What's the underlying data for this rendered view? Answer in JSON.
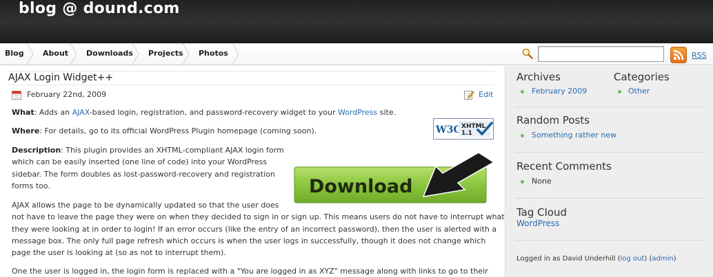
{
  "header": {
    "site_title": "blog @ dound.com"
  },
  "nav": {
    "items": [
      "Blog",
      "About",
      "Downloads",
      "Projects",
      "Photos"
    ],
    "search_placeholder": "",
    "rss_label": "RSS"
  },
  "post": {
    "title": "AJAX Login Widget++",
    "date": "February 22nd, 2009",
    "edit_label": "Edit",
    "what_label": "What",
    "what_text_1": ": Adds an ",
    "what_link_1": "AJAX",
    "what_text_2": "-based login, registration, and password-recovery widget to your ",
    "what_link_2": "WordPress",
    "what_text_3": " site.",
    "where_label": "Where",
    "where_text": ": For details, go to its official WordPress Plugin homepage (coming soon).",
    "desc_label": "Description",
    "desc_line_1": ": This plugin provides an XHTML-compliant AJAX login form",
    "desc_line_2": "which can be easily inserted (one line of code) into your WordPress",
    "desc_line_3": "sidebar. The form doubles as lost-password-recovery and registration",
    "desc_line_4": "forms too.",
    "ajax_line_1": "AJAX allows the page to be dynamically updated so that the user does",
    "ajax_line_2": "not have to leave the page they were on when they decided to sign in or sign up. This means users do not have to interrupt what",
    "ajax_line_3": "they were looking at in order to login! If an error occurs (like the entry of an incorrect password), then the user is alerted with a",
    "ajax_line_4": "message box. The only full page refresh which occurs is when the user logs in successfully, though it does not change which",
    "ajax_line_5": "page the user is looking at (so as not to interrupt them).",
    "last_line": "One the user is logged in, the login form is replaced with a \"You are logged in as XYZ\" message along with links to go to their",
    "w3c_badge": {
      "w3c": "W3C",
      "xhtml": "XHTML",
      "version": "1.1"
    },
    "download_label": "Download"
  },
  "sidebar": {
    "archives": {
      "heading": "Archives",
      "items": [
        "February 2009"
      ]
    },
    "categories": {
      "heading": "Categories",
      "items": [
        "Other"
      ]
    },
    "random_posts": {
      "heading": "Random Posts",
      "items": [
        "Something rather new"
      ]
    },
    "recent_comments": {
      "heading": "Recent Comments",
      "items": [
        "None"
      ]
    },
    "tag_cloud": {
      "heading": "Tag Cloud",
      "items": [
        "WordPress"
      ]
    },
    "logged_in": {
      "prefix": "Logged in as David Underhill (",
      "logout": "log out",
      "middle": ") (",
      "admin": "admin",
      "suffix": ")"
    }
  },
  "colors": {
    "link": "#2a6bb0",
    "bullet": "#6bbf5e",
    "download_green": "#8cc63f",
    "rss_orange": "#e97d21"
  }
}
